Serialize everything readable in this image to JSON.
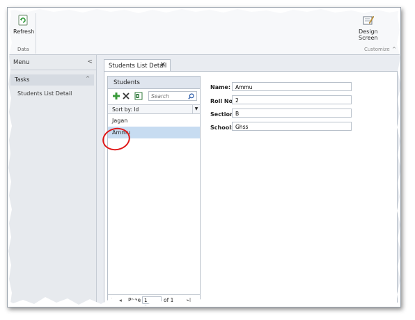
{
  "ribbon": {
    "refresh_label": "Refresh",
    "data_group_label": "Data",
    "design_screen_label_1": "Design",
    "design_screen_label_2": "Screen",
    "customize_group_label": "Customize",
    "collapse_icon": "chevron-up-icon"
  },
  "nav": {
    "title": "Menu",
    "collapse_glyph": "<",
    "tasks_label": "Tasks",
    "tasks_chevron": "^",
    "items": [
      {
        "label": "Students List Detail"
      }
    ]
  },
  "tab": {
    "label": "Students List Detail",
    "close_glyph": "✕"
  },
  "list": {
    "title": "Students",
    "search_placeholder": "Search",
    "sort_label": "Sort by: Id",
    "sort_glyph": "▼",
    "items": [
      "Jagan",
      "Ammu"
    ],
    "selected_index": 1
  },
  "pager": {
    "first_glyph": "|◂",
    "prev_glyph": "◂",
    "page_label": "Page",
    "page_value": "1",
    "of_label": "of 1",
    "next_glyph": "▸",
    "last_glyph": "▸|"
  },
  "form": {
    "name_label": "Name:",
    "name_value": "Ammu",
    "roll_label": "Roll No:",
    "roll_value": "2",
    "section_label": "Section:",
    "section_value": "B",
    "school_label": "School:",
    "school_value": "Ghss"
  },
  "colors": {
    "selection": "#c7dcf1",
    "annotation": "#e01818",
    "accent_green": "#3a9a3a"
  }
}
